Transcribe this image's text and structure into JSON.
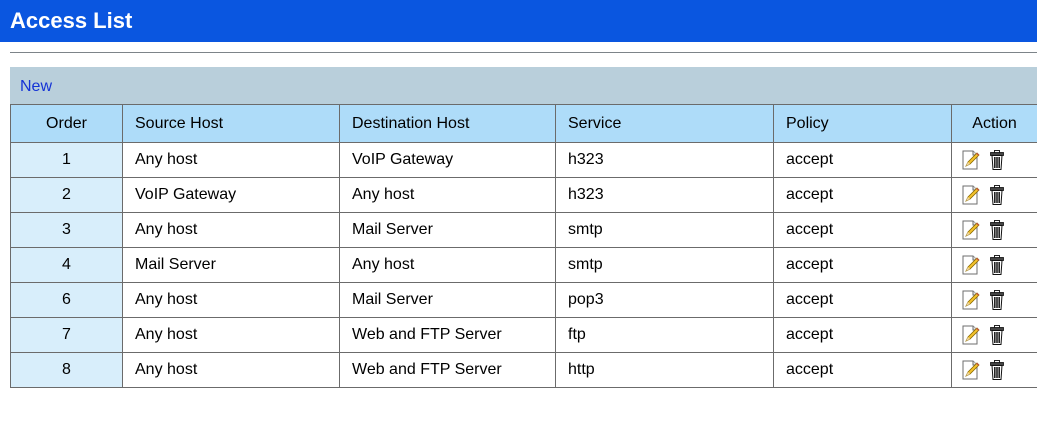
{
  "header": {
    "title": "Access List"
  },
  "toolbar": {
    "new_label": "New"
  },
  "table": {
    "columns": {
      "order": "Order",
      "source": "Source Host",
      "destination": "Destination Host",
      "service": "Service",
      "policy": "Policy",
      "action": "Action"
    },
    "rows": [
      {
        "order": "1",
        "source": "Any host",
        "destination": "VoIP Gateway",
        "service": "h323",
        "policy": "accept"
      },
      {
        "order": "2",
        "source": "VoIP Gateway",
        "destination": "Any host",
        "service": "h323",
        "policy": "accept"
      },
      {
        "order": "3",
        "source": "Any host",
        "destination": "Mail Server",
        "service": "smtp",
        "policy": "accept"
      },
      {
        "order": "4",
        "source": "Mail Server",
        "destination": "Any host",
        "service": "smtp",
        "policy": "accept"
      },
      {
        "order": "6",
        "source": "Any host",
        "destination": "Mail Server",
        "service": "pop3",
        "policy": "accept"
      },
      {
        "order": "7",
        "source": "Any host",
        "destination": "Web and FTP Server",
        "service": "ftp",
        "policy": "accept"
      },
      {
        "order": "8",
        "source": "Any host",
        "destination": "Web and FTP Server",
        "service": "http",
        "policy": "accept"
      }
    ],
    "row_icons": {
      "edit": "edit-icon",
      "delete": "trash-icon"
    }
  },
  "colors": {
    "title_bar": "#0a56e0",
    "toolbar": "#b9cfdb",
    "header_cell": "#aedcf9",
    "order_cell": "#d8eefb",
    "link": "#1433d6"
  }
}
